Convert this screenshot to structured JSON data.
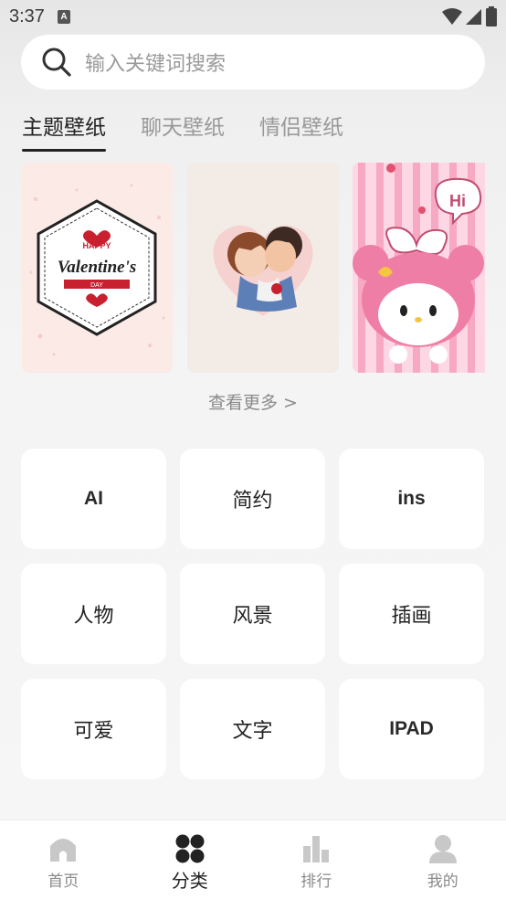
{
  "status_bar": {
    "time": "3:37",
    "notification_icon": "A"
  },
  "search": {
    "placeholder": "输入关键词搜索"
  },
  "tabs": [
    {
      "label": "主题壁纸",
      "active": true
    },
    {
      "label": "聊天壁纸",
      "active": false
    },
    {
      "label": "情侣壁纸",
      "active": false
    }
  ],
  "wallpapers": [
    {
      "id": "valentines",
      "text_top": "HAPPY",
      "text_main": "Valentine's",
      "text_bottom": "DAY"
    },
    {
      "id": "couple-heart"
    },
    {
      "id": "pink-cat",
      "bubble": "Hi"
    }
  ],
  "more_link": "查看更多 >",
  "categories": [
    {
      "label": "AI"
    },
    {
      "label": "简约"
    },
    {
      "label": "ins"
    },
    {
      "label": "人物"
    },
    {
      "label": "风景"
    },
    {
      "label": "插画"
    },
    {
      "label": "可爱"
    },
    {
      "label": "文字"
    },
    {
      "label": "IPAD"
    }
  ],
  "bottom_nav": [
    {
      "label": "首页",
      "icon": "home-icon",
      "active": false
    },
    {
      "label": "分类",
      "icon": "category-icon",
      "active": true
    },
    {
      "label": "排行",
      "icon": "ranking-icon",
      "active": false
    },
    {
      "label": "我的",
      "icon": "profile-icon",
      "active": false
    }
  ],
  "colors": {
    "accent": "#222222",
    "inactive": "#8a8a8a",
    "icon_inactive": "#c8c8c8"
  }
}
